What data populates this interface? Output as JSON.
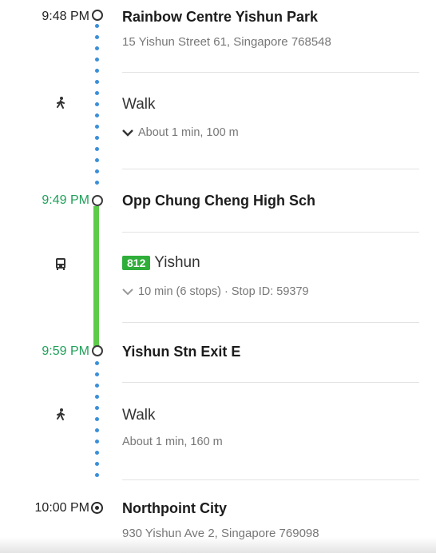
{
  "steps": [
    {
      "time": "9:48 PM",
      "title": "Rainbow Centre Yishun Park",
      "address": "15 Yishun Street 61, Singapore 768548"
    },
    {
      "mode": "Walk",
      "detail": "About 1 min, 100 m"
    },
    {
      "time": "9:49 PM",
      "title": "Opp Chung Cheng High Sch"
    },
    {
      "route": "812",
      "destination": "Yishun",
      "detail": "10 min (6 stops) · Stop ID: 59379"
    },
    {
      "time": "9:59 PM",
      "title": "Yishun Stn Exit E"
    },
    {
      "mode": "Walk",
      "detail": "About 1 min, 160 m"
    },
    {
      "time": "10:00 PM",
      "title": "Northpoint City",
      "address": "930 Yishun Ave 2, Singapore 769098"
    }
  ],
  "icons": {
    "walk1": "walking-person-icon",
    "bus": "bus-icon",
    "walk2": "walking-person-icon",
    "expand": "chevron-down-icon"
  },
  "colors": {
    "transit_green": "#20a05a",
    "bus_line": "#5ccb4a",
    "route_badge": "#2fae3a",
    "walk_dots": "#3b8fd8"
  }
}
